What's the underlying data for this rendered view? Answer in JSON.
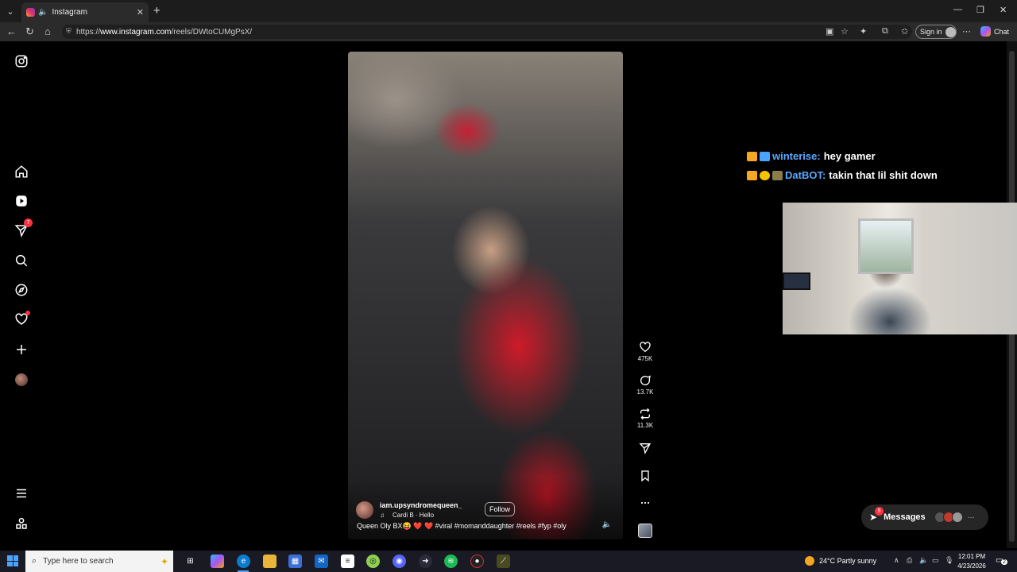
{
  "browser": {
    "tab_title": "Instagram",
    "url_prefix": "https://",
    "url_domain": "www.instagram.com",
    "url_path": "/reels/DWtoCUMgPsX/",
    "signin_label": "Sign in",
    "chat_label": "Chat"
  },
  "sidebar": {
    "notifications_badge": "7"
  },
  "reel": {
    "username": "iam.upsyndromequeen_",
    "audio": "Cardi B · Hello",
    "follow_label": "Follow",
    "caption": "Queen Oly BX😝 ❤️ ❤️ #viral #momanddaughter #reels #fyp #oly",
    "likes": "475K",
    "comments": "13.7K",
    "reposts": "11.3K"
  },
  "stream_chat": [
    {
      "user": "winterise:",
      "message": "hey gamer"
    },
    {
      "user": "DatBOT:",
      "message": "takin that lil shit down"
    }
  ],
  "messages": {
    "label": "Messages",
    "badge": "5"
  },
  "taskbar": {
    "search_placeholder": "Type here to search",
    "weather": "24°C  Partly sunny",
    "time": "12:01 PM",
    "date": "4/23/2026",
    "notif_count": "2"
  },
  "colors": {
    "accent_blue": "#5aa7ff",
    "notification_red": "#ff3040",
    "page_bg": "#000000"
  }
}
